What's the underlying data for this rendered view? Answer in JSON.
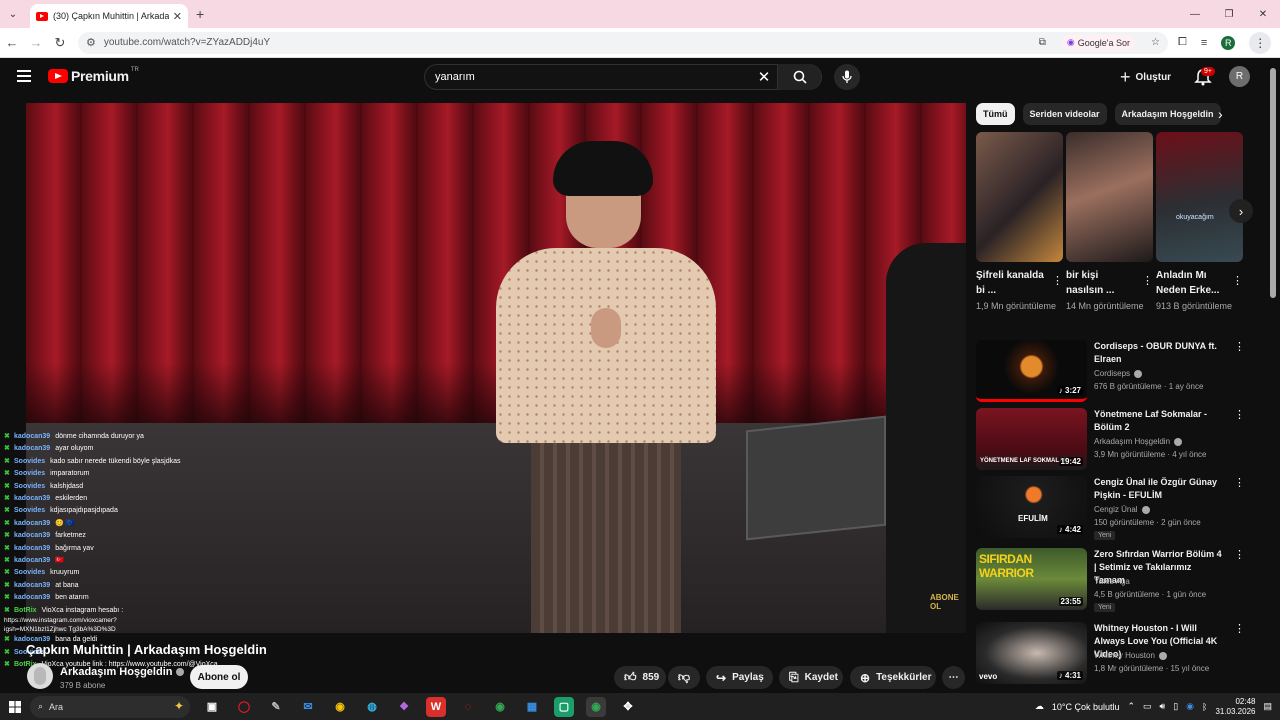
{
  "browser": {
    "tab_title": "(30) Çapkın Muhittin | Arkadaşım",
    "url": "youtube.com/watch?v=ZYazADDj4uY",
    "google_sor": "Google'a Sor",
    "profile_initial": "R"
  },
  "header": {
    "logo_text": "Premium",
    "logo_region": "TR",
    "search_query": "yanarım",
    "create_label": "Oluştur",
    "notifications_badge": "9+",
    "avatar_initial": "R"
  },
  "video": {
    "watermark": "ABONE OL",
    "title": "Çapkın Muhittin | Arkadaşım Hoşgeldin",
    "channel_name": "Arkadaşım Hoşgeldin",
    "subscribers": "379 B abone",
    "subscribe_label": "Abone ol",
    "likes": "859",
    "share_label": "Paylaş",
    "save_label": "Kaydet",
    "thanks_label": "Teşekkürler"
  },
  "chat": [
    {
      "user": "kadocan39",
      "msg": "dönme cihamnda duruyor ya",
      "bot": false
    },
    {
      "user": "kadocan39",
      "msg": "ayar oluyom",
      "bot": false
    },
    {
      "user": "Soovides",
      "msg": "kado sabır nerede tükendi böyle şlasjdkas",
      "bot": false
    },
    {
      "user": "Soovides",
      "msg": "imparatorum",
      "bot": false
    },
    {
      "user": "Soovides",
      "msg": "kalshjdasd",
      "bot": false
    },
    {
      "user": "kadocan39",
      "msg": "eskilerden",
      "bot": false
    },
    {
      "user": "Soovides",
      "msg": "kdjasıpajdıpasjdıpada",
      "bot": false
    },
    {
      "user": "kadocan39",
      "msg": "😊 🇪🇺",
      "bot": false
    },
    {
      "user": "kadocan39",
      "msg": "farketmez",
      "bot": false
    },
    {
      "user": "kadocan39",
      "msg": "bağırma yav",
      "bot": false
    },
    {
      "user": "kadocan39",
      "msg": "🇹🇷",
      "bot": false
    },
    {
      "user": "Soovides",
      "msg": "kruuyrum",
      "bot": false
    },
    {
      "user": "kadocan39",
      "msg": "at bana",
      "bot": false
    },
    {
      "user": "kadocan39",
      "msg": "ben atarım",
      "bot": false
    },
    {
      "user": "BotRix",
      "msg": "VioXca instagram hesabı :",
      "bot": true
    }
  ],
  "chat_link": "https://www.instagram.com/vioxcamer?igsh=MXN1bzl1Zjhwc Tg3bA%3D%3D",
  "chat_tail": [
    {
      "user": "kadocan39",
      "msg": "bana da geldi",
      "bot": false
    },
    {
      "user": "Soovides",
      "msg": "",
      "bot": false
    },
    {
      "user": "BotRix",
      "msg": "VioXca youtube link : https://www.youtube.com/@VioXca",
      "bot": true
    }
  ],
  "chips": [
    "Tümü",
    "Seriden videolar",
    "Arkadaşım Hoşgeldin"
  ],
  "shorts": [
    {
      "title": "Şifreli kanalda bi ...",
      "views": "1,9 Mn görüntüleme",
      "label": ""
    },
    {
      "title": "bir kişi nasılsın ...",
      "views": "14 Mn görüntüleme",
      "label": ""
    },
    {
      "title": "Anladın Mı Neden Erke...",
      "views": "913 B görüntüleme",
      "label": "okuyacağım"
    }
  ],
  "videos": [
    {
      "title": "Cordiseps - OBUR DUNYA ft. Elraen",
      "channel": "Cordiseps",
      "meta": "676 B görüntüleme · 1 ay önce",
      "duration": "♪ 3:27",
      "new": "",
      "thumb_text": ""
    },
    {
      "title": "Yönetmene Laf Sokmalar - Bölüm 2",
      "channel": "Arkadaşım Hoşgeldin",
      "meta": "3,9 Mn görüntüleme · 4 yıl önce",
      "duration": "19:42",
      "new": "",
      "thumb_text": "YÖNETMENE LAF SOKMALAR"
    },
    {
      "title": "Cengiz Ünal ile Özgür Günay Pişkin - EFULİM",
      "channel": "Cengiz Ünal",
      "meta": "150 görüntüleme · 2 gün önce",
      "duration": "♪ 4:42",
      "new": "Yeni",
      "thumb_text": "EFULİM"
    },
    {
      "title": "Zero Sıfırdan Warrior Bölüm 4 | Setimiz ve Takılarımız Tamam",
      "channel": "Yafes Aga",
      "meta": "4,5 B görüntüleme · 1 gün önce",
      "duration": "23:55",
      "new": "Yeni",
      "thumb_text": "SIFIRDAN WARRIOR"
    },
    {
      "title": "Whitney Houston - I Will Always Love You (Official 4K Video)",
      "channel": "Whitney Houston",
      "meta": "1,8 Mr görüntüleme · 15 yıl önce",
      "duration": "♪ 4:31",
      "new": "",
      "thumb_text": "vevo"
    }
  ],
  "taskbar": {
    "search_placeholder": "Ara",
    "weather": "10°C  Çok bulutlu",
    "time": "02:48",
    "date": "31.03.2026"
  },
  "colors": {
    "brand": "#ff0000",
    "bg": "#0f0f0f",
    "chat_user": "#79b4ff",
    "bot": "#4cd24c"
  }
}
